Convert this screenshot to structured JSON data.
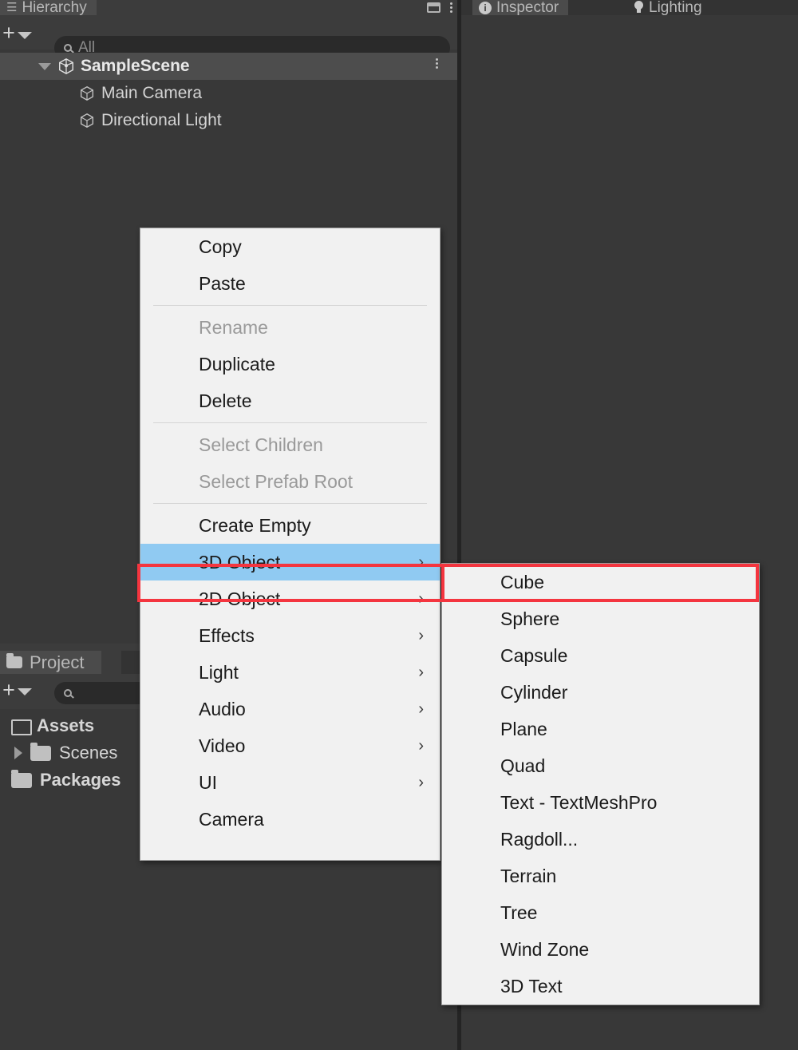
{
  "app": "Unity Editor",
  "hierarchy": {
    "tab_label": "Hierarchy",
    "tab_icon": "hamburger-icon",
    "maximize_icon": "maximize-icon",
    "menu_icon": "kebab-menu-icon",
    "add_button_label": "+",
    "dropdown_icon": "chevron-down-icon",
    "search": {
      "placeholder": "All",
      "value": "All",
      "icon": "search-icon"
    },
    "tree": [
      {
        "label": "SampleScene",
        "icon": "unity-scene-icon",
        "depth": 0,
        "expanded": true,
        "selected": true,
        "has_kebab": true
      },
      {
        "label": "Main Camera",
        "icon": "gameobject-cube-icon",
        "depth": 1,
        "expanded": false,
        "selected": false,
        "has_kebab": false
      },
      {
        "label": "Directional Light",
        "icon": "gameobject-cube-icon",
        "depth": 1,
        "expanded": false,
        "selected": false,
        "has_kebab": false
      }
    ]
  },
  "project": {
    "tab_label": "Project",
    "tab_icon": "folder-icon",
    "add_button_label": "+",
    "dropdown_icon": "chevron-down-icon",
    "search": {
      "placeholder": "",
      "value": "",
      "icon": "search-icon"
    },
    "tree": [
      {
        "label": "Assets",
        "icon": "folder-open-icon",
        "depth": 0,
        "expandable": true
      },
      {
        "label": "Scenes",
        "icon": "folder-icon",
        "depth": 1,
        "expandable": true
      },
      {
        "label": "Packages",
        "icon": "folder-icon",
        "depth": 0,
        "expandable": true
      }
    ]
  },
  "inspector": {
    "tabs": [
      {
        "label": "Inspector",
        "icon": "info-icon",
        "active": true
      },
      {
        "label": "Lighting",
        "icon": "lightbulb-icon",
        "active": false
      }
    ]
  },
  "context_menu": {
    "items": [
      {
        "label": "Copy",
        "disabled": false,
        "submenu": false,
        "highlighted": false
      },
      {
        "label": "Paste",
        "disabled": false,
        "submenu": false,
        "highlighted": false
      },
      {
        "separator": true
      },
      {
        "label": "Rename",
        "disabled": true,
        "submenu": false,
        "highlighted": false
      },
      {
        "label": "Duplicate",
        "disabled": false,
        "submenu": false,
        "highlighted": false
      },
      {
        "label": "Delete",
        "disabled": false,
        "submenu": false,
        "highlighted": false
      },
      {
        "separator": true
      },
      {
        "label": "Select Children",
        "disabled": true,
        "submenu": false,
        "highlighted": false
      },
      {
        "label": "Select Prefab Root",
        "disabled": true,
        "submenu": false,
        "highlighted": false
      },
      {
        "separator": true
      },
      {
        "label": "Create Empty",
        "disabled": false,
        "submenu": false,
        "highlighted": false
      },
      {
        "label": "3D Object",
        "disabled": false,
        "submenu": true,
        "highlighted": true
      },
      {
        "label": "2D Object",
        "disabled": false,
        "submenu": true,
        "highlighted": false
      },
      {
        "label": "Effects",
        "disabled": false,
        "submenu": true,
        "highlighted": false
      },
      {
        "label": "Light",
        "disabled": false,
        "submenu": true,
        "highlighted": false
      },
      {
        "label": "Audio",
        "disabled": false,
        "submenu": true,
        "highlighted": false
      },
      {
        "label": "Video",
        "disabled": false,
        "submenu": true,
        "highlighted": false
      },
      {
        "label": "UI",
        "disabled": false,
        "submenu": true,
        "highlighted": false
      },
      {
        "label": "Camera",
        "disabled": false,
        "submenu": false,
        "highlighted": false
      }
    ],
    "submenu_arrow": "›"
  },
  "submenu": {
    "parent": "3D Object",
    "items": [
      {
        "label": "Cube",
        "highlighted": true
      },
      {
        "label": "Sphere",
        "highlighted": false
      },
      {
        "label": "Capsule",
        "highlighted": false
      },
      {
        "label": "Cylinder",
        "highlighted": false
      },
      {
        "label": "Plane",
        "highlighted": false
      },
      {
        "label": "Quad",
        "highlighted": false
      },
      {
        "label": "Text - TextMeshPro",
        "highlighted": false
      },
      {
        "label": "Ragdoll...",
        "highlighted": false
      },
      {
        "label": "Terrain",
        "highlighted": false
      },
      {
        "label": "Tree",
        "highlighted": false
      },
      {
        "label": "Wind Zone",
        "highlighted": false
      },
      {
        "label": "3D Text",
        "highlighted": false
      }
    ]
  },
  "annotations": [
    {
      "name": "red-highlight-3d-object",
      "target": "3D Object",
      "color": "#f4353f"
    },
    {
      "name": "red-highlight-cube",
      "target": "Cube",
      "color": "#f4353f"
    }
  ],
  "colors": {
    "panel_bg": "#383838",
    "toolbar_bg": "#3c3c3c",
    "gutter_bg": "#2b2b2b",
    "row_selected": "#4d4d4d",
    "menu_bg": "#f1f1f1",
    "menu_highlight": "#90caf2",
    "annotation": "#f4353f"
  }
}
